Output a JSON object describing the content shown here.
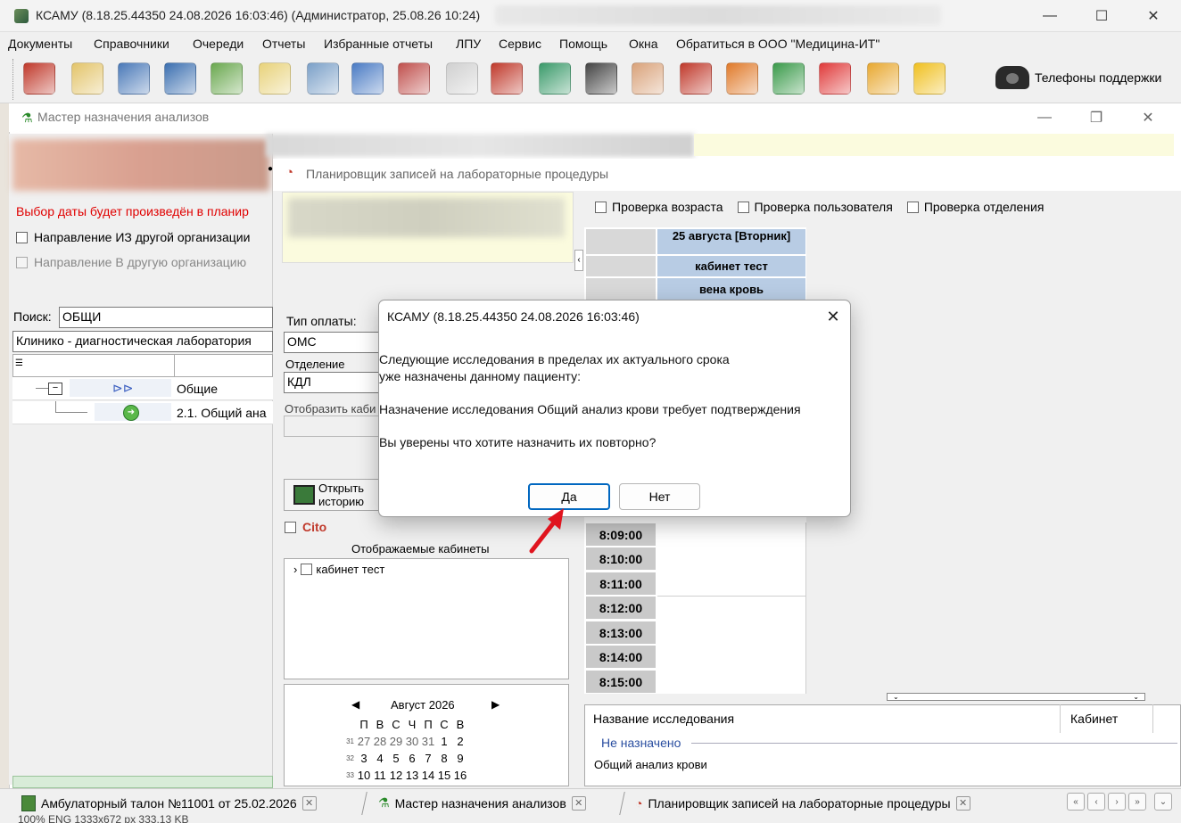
{
  "window": {
    "title": "КСАМУ (8.18.25.44350 24.08.2026 16:03:46) (Администратор, 25.08.26 10:24)",
    "minimize": "—",
    "maximize": "☐",
    "close": "✕"
  },
  "menu": [
    "Документы",
    "Справочники",
    "Очереди",
    "Отчеты",
    "Избранные отчеты",
    "ЛПУ",
    "Сервис",
    "Помощь",
    "Окна",
    "Обратиться в ООО \"Медицина-ИТ\""
  ],
  "toolbar": {
    "icons": [
      {
        "name": "doctor-icon",
        "color": "#c0392b"
      },
      {
        "name": "journal-icon",
        "color": "#e3c46a"
      },
      {
        "name": "card-icon",
        "color": "#4a79b8"
      },
      {
        "name": "id-card-icon",
        "color": "#3b6fb0"
      },
      {
        "name": "lab-tubes-icon",
        "color": "#6aa84f"
      },
      {
        "name": "notepad-icon",
        "color": "#e8d27a"
      },
      {
        "name": "syringe-icon",
        "color": "#7ba0c8"
      },
      {
        "name": "calendar-clock-icon",
        "color": "#4a7bc4"
      },
      {
        "name": "pills-icon",
        "color": "#c0504d"
      },
      {
        "name": "medkit-icon",
        "color": "#d0d0d0"
      },
      {
        "name": "capsules-icon",
        "color": "#c0392b"
      },
      {
        "name": "tablet-icon",
        "color": "#3a9a6a"
      },
      {
        "name": "barcode-scanner-icon",
        "color": "#444444"
      },
      {
        "name": "nurse-icon",
        "color": "#d9a27a"
      },
      {
        "name": "red-book-icon",
        "color": "#c0392b"
      },
      {
        "name": "schedule-icon",
        "color": "#e07a2a"
      },
      {
        "name": "access-card-icon",
        "color": "#3a9a4a"
      },
      {
        "name": "apps-icon",
        "color": "#e03a3a"
      },
      {
        "name": "lock-icon",
        "color": "#e8a830"
      },
      {
        "name": "chat-icon",
        "color": "#f0c020"
      }
    ],
    "support_label": "Телефоны поддержки"
  },
  "wizard": {
    "title": "Мастер назначения анализов",
    "date_notice": "Выбор даты будет произведён в планир",
    "referral_from": "Направление ИЗ другой организации",
    "referral_to": "Направление В другую организацию",
    "search_label": "Поиск:",
    "search_value": "ОБЩИ",
    "lab_combo": "Клинико - диагностическая лаборатория",
    "tree": [
      {
        "label": "Общие"
      },
      {
        "label": "2.1. Общий ана"
      }
    ]
  },
  "planner": {
    "title": "Планировщик записей на лабораторные процедуры",
    "payment_label": "Тип оплаты:",
    "payment_value": "ОМС",
    "department_label": "Отделение",
    "department_value": "КДЛ",
    "show_label": "Отобразить каби",
    "history_btn": "Открыть историю",
    "cito": "Cito",
    "cabinets_label": "Отображаемые кабинеты",
    "cabinet_item": "кабинет тест",
    "checks": [
      "Проверка возраста",
      "Проверка пользователя",
      "Проверка отделения"
    ],
    "day_header": "25 августа [Вторник]",
    "cabinet_header": "кабинет тест",
    "service_header": "вена кровь",
    "times": [
      "8:09:00",
      "8:10:00",
      "8:11:00",
      "8:12:00",
      "8:13:00",
      "8:14:00",
      "8:15:00"
    ],
    "calendar": {
      "month": "Август 2026",
      "weekdays": [
        "П",
        "В",
        "С",
        "Ч",
        "П",
        "С",
        "В"
      ],
      "weeks": [
        {
          "n": "31",
          "days": [
            "27",
            "28",
            "29",
            "30",
            "31",
            "1",
            "2"
          ]
        },
        {
          "n": "32",
          "days": [
            "3",
            "4",
            "5",
            "6",
            "7",
            "8",
            "9"
          ]
        },
        {
          "n": "33",
          "days": [
            "10",
            "11",
            "12",
            "13",
            "14",
            "15",
            "16"
          ]
        }
      ]
    },
    "table": {
      "col_name": "Название исследования",
      "col_cabinet": "Кабинет",
      "group": "Не назначено",
      "row": "Общий анализ крови"
    }
  },
  "dialog": {
    "title": "КСАМУ (8.18.25.44350 24.08.2026 16:03:46)",
    "line1": "Следующие исследования в пределах их актуального срока",
    "line2": "уже назначены данному пациенту:",
    "line3": "Назначение исследования Общий анализ крови требует подтверждения",
    "line4": "Вы уверены что хотите назначить их повторно?",
    "yes": "Да",
    "no": "Нет"
  },
  "tabs": [
    {
      "label": "Амбулаторный талон №11001 от 25.02.2026"
    },
    {
      "label": "Мастер назначения анализов"
    },
    {
      "label": "Планировщик записей на лабораторные процедуры"
    }
  ],
  "status": "100%   ENG      1333x672 px      333.13 KB"
}
